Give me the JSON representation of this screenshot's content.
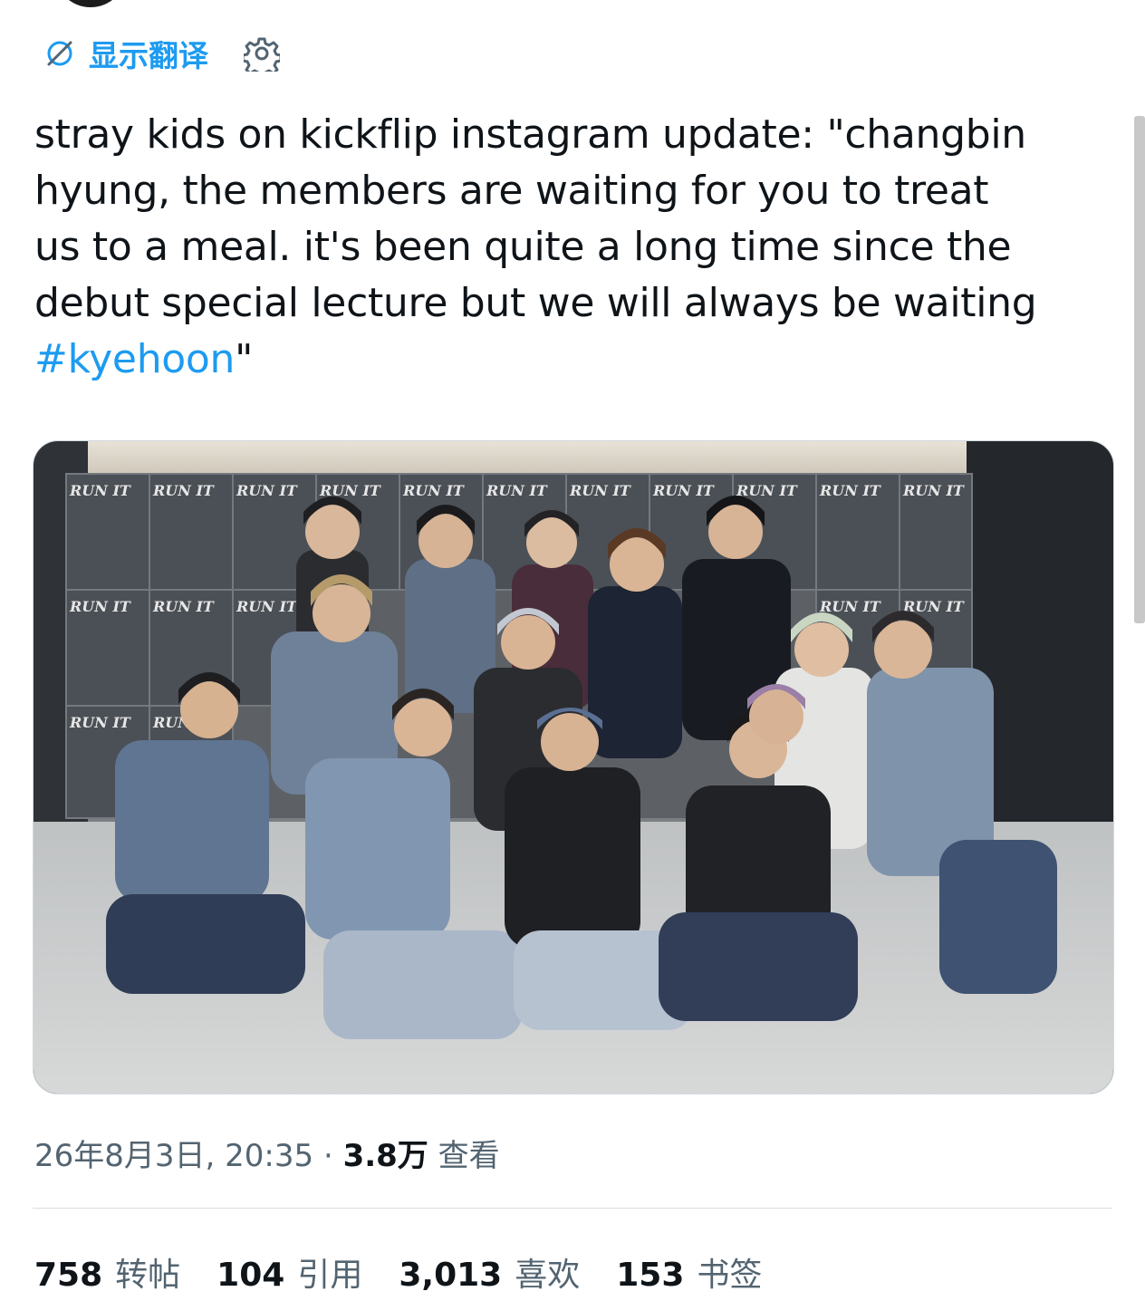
{
  "translate": {
    "label": "显示翻译",
    "translate_icon": "translate-off-icon",
    "settings_icon": "gear-icon"
  },
  "tweet": {
    "lines": [
      "stray kids on kickflip instagram update: \"changbin",
      "hyung, the members are waiting for you to treat",
      "us to a meal. it's been quite a long time since the",
      "debut special lecture but we will always be waiting"
    ],
    "hashtag": "#kyehoon",
    "closing_quote": "\""
  },
  "media": {
    "poster_text": "RUN IT",
    "image_subject": "group photo of thirteen people posing in front of a poster wall"
  },
  "meta": {
    "date": "26年8月3日",
    "time": "20:35",
    "separator": "·",
    "views_count": "3.8万",
    "views_label": "查看"
  },
  "stats": [
    {
      "count": "758",
      "label": "转帖"
    },
    {
      "count": "104",
      "label": "引用"
    },
    {
      "count": "3,013",
      "label": "喜欢"
    },
    {
      "count": "153",
      "label": "书签"
    }
  ],
  "colors": {
    "accent": "#1d9bf0",
    "text_primary": "#0f1419",
    "text_secondary": "#536471",
    "divider": "#d9dee2"
  }
}
